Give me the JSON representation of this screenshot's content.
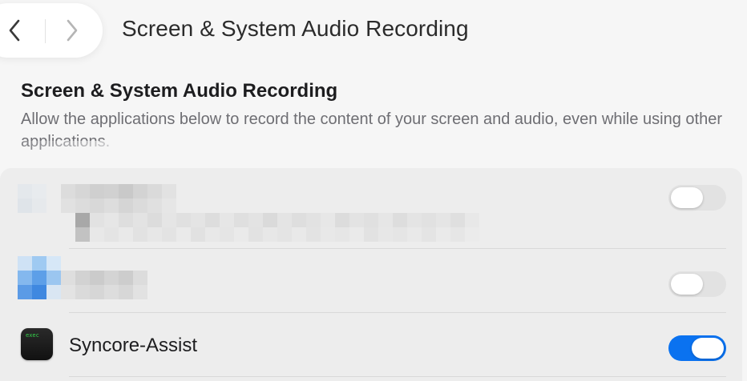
{
  "toolbar": {
    "title": "Screen & System Audio Recording",
    "back_icon": "chevron-left-icon",
    "forward_icon": "chevron-right-icon"
  },
  "section": {
    "title": "Screen & System Audio Recording",
    "description": "Allow the applications below to record the content of your screen and audio, even while using other applications."
  },
  "apps": [
    {
      "name": "",
      "enabled": false,
      "redacted": true
    },
    {
      "name": "",
      "enabled": false,
      "redacted": true
    },
    {
      "name": "Syncore-Assist",
      "enabled": true,
      "redacted": false,
      "icon_text": "exec"
    }
  ],
  "colors": {
    "toggle_on": "#0a72f0",
    "toggle_off": "#e2e2e2",
    "panel": "#ededed",
    "background": "#f6f6f6"
  }
}
